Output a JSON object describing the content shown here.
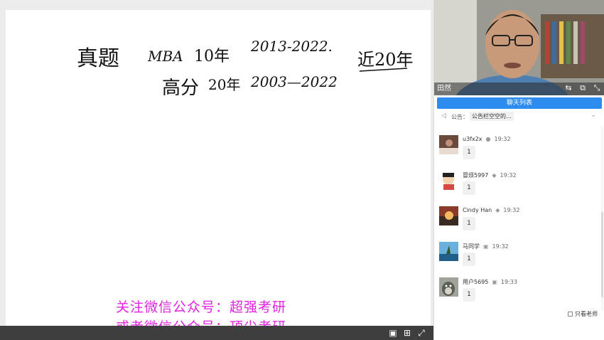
{
  "board": {
    "handwriting": {
      "line1": [
        "真题",
        "MBA",
        "10年",
        "2013-2022."
      ],
      "line2": [
        "高分",
        "20年",
        "2003—2022",
        "近20年"
      ]
    },
    "watermark": {
      "line1": "关注微信公众号：超强考研",
      "line2": "或者微信公众号：顶尖考研"
    },
    "toolbar": {
      "icons": [
        "fit-icon",
        "expand-icon",
        "fullscreen-icon"
      ]
    }
  },
  "video": {
    "presenter_name": "田然",
    "icons": [
      "switch-icon",
      "popout-icon",
      "close-icon"
    ]
  },
  "chat": {
    "tab_label": "聊天列表",
    "notice_label": "公告：",
    "notice_text": "公告栏空空的…",
    "messages": [
      {
        "user": "u3fx2x",
        "time": "19:32",
        "text": "1",
        "avatar_color": "#6a4a3c"
      },
      {
        "user": "冒烦5997",
        "time": "19:32",
        "text": "1",
        "avatar_color": "#d64a44"
      },
      {
        "user": "Cindy Han",
        "time": "19:32",
        "text": "1",
        "avatar_color": "#c8653a"
      },
      {
        "user": "马同学",
        "time": "19:32",
        "text": "1",
        "avatar_color": "#3b7bb0"
      },
      {
        "user": "用户5695",
        "time": "19:33",
        "text": "1",
        "avatar_color": "#7a7f72"
      }
    ],
    "teacher_only_label": "只看老师",
    "colors": {
      "accent": "#2d8cf0",
      "watermark": "#e024e0"
    }
  }
}
